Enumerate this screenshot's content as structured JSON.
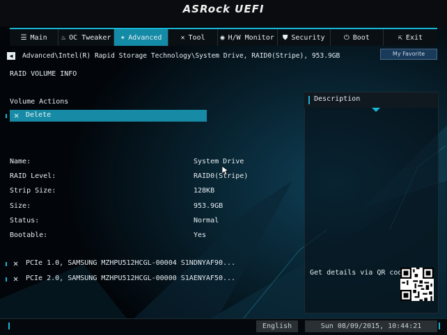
{
  "app": {
    "title": "ASRock UEFI"
  },
  "nav": {
    "tabs": [
      {
        "label": "Main",
        "icon": "list-icon"
      },
      {
        "label": "OC Tweaker",
        "icon": "flame-icon"
      },
      {
        "label": "Advanced",
        "icon": "star-icon"
      },
      {
        "label": "Tool",
        "icon": "tools-icon"
      },
      {
        "label": "H/W Monitor",
        "icon": "monitor-icon"
      },
      {
        "label": "Security",
        "icon": "shield-icon"
      },
      {
        "label": "Boot",
        "icon": "power-icon"
      },
      {
        "label": "Exit",
        "icon": "exit-icon"
      }
    ],
    "active_index": 2
  },
  "my_favorite": "My Favorite",
  "breadcrumb": "Advanced\\Intel(R) Rapid Storage Technology\\System Drive, RAID0(Stripe), 953.9GB",
  "section_title": "RAID VOLUME INFO",
  "volume_actions": {
    "label": "Volume Actions",
    "delete_label": "Delete"
  },
  "info": [
    {
      "label": "Name:",
      "value": "System Drive"
    },
    {
      "label": "RAID Level:",
      "value": "RAID0(Stripe)"
    },
    {
      "label": "Strip Size:",
      "value": "128KB"
    },
    {
      "label": "Size:",
      "value": "953.9GB"
    },
    {
      "label": "Status:",
      "value": "Normal"
    },
    {
      "label": "Bootable:",
      "value": "Yes"
    }
  ],
  "disks": [
    {
      "label": "PCIe 1.0, SAMSUNG MZHPU512HCGL-00004 S1NDNYAF90..."
    },
    {
      "label": "PCIe 2.0, SAMSUNG MZHPU512HCGL-00000 S1AENYAF50..."
    }
  ],
  "description": {
    "title": "Description",
    "qr_text": "Get details via QR code"
  },
  "status_bar": {
    "language": "English",
    "datetime": "Sun 08/09/2015, 10:44:21"
  },
  "colors": {
    "accent": "#1ab6d6",
    "selection": "#178aa5",
    "active_tab": "#138aa6"
  }
}
